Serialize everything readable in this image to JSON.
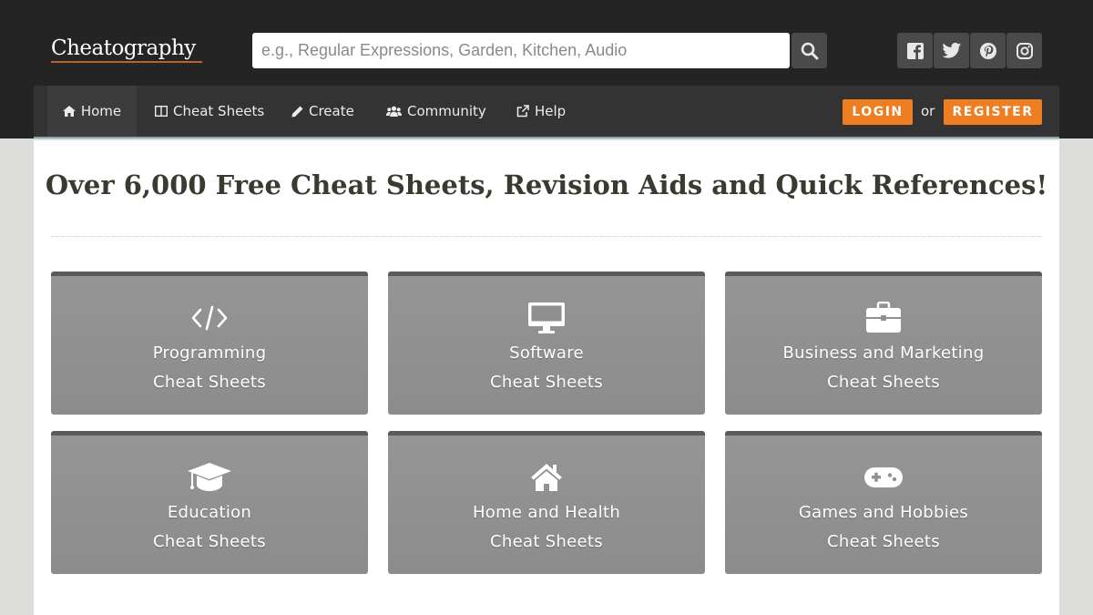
{
  "header": {
    "logo_text": "Cheatography",
    "search": {
      "placeholder": "e.g., Regular Expressions, Garden, Kitchen, Audio",
      "value": ""
    },
    "search_icon": "search-icon",
    "social": [
      "facebook-icon",
      "twitter-icon",
      "pinterest-icon",
      "instagram-icon"
    ]
  },
  "nav": {
    "items": [
      {
        "label": "Home",
        "icon": "home-icon",
        "active": true
      },
      {
        "label": "Cheat Sheets",
        "icon": "columns-icon",
        "active": false
      },
      {
        "label": "Create",
        "icon": "pencil-icon",
        "active": false
      },
      {
        "label": "Community",
        "icon": "users-icon",
        "active": false
      },
      {
        "label": "Help",
        "icon": "external-link-icon",
        "active": false
      }
    ],
    "login_label": "LOGIN",
    "or_label": "or",
    "register_label": "REGISTER"
  },
  "main": {
    "headline": "Over 6,000 Free Cheat Sheets, Revision Aids and Quick References!",
    "tiles": [
      {
        "line1": "Programming",
        "line2": "Cheat Sheets",
        "icon": "code-icon"
      },
      {
        "line1": "Software",
        "line2": "Cheat Sheets",
        "icon": "monitor-icon"
      },
      {
        "line1": "Business and Marketing",
        "line2": "Cheat Sheets",
        "icon": "briefcase-icon"
      },
      {
        "line1": "Education",
        "line2": "Cheat Sheets",
        "icon": "graduation-cap-icon"
      },
      {
        "line1": "Home and Health",
        "line2": "Cheat Sheets",
        "icon": "house-icon"
      },
      {
        "line1": "Games and Hobbies",
        "line2": "Cheat Sheets",
        "icon": "gamepad-icon"
      }
    ]
  },
  "colors": {
    "header_bg": "#242424",
    "nav_bg": "#333333",
    "accent_orange": "#ef7d22",
    "tile_bg": "#959595",
    "headline": "#3a3a30"
  }
}
